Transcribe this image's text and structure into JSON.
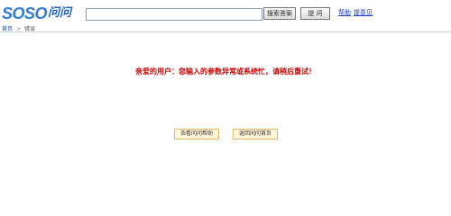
{
  "header": {
    "logo_soso": "SOSO",
    "logo_wenwen": "问问",
    "search_value": "",
    "search_button": "搜索答案",
    "ask_button": "提 问",
    "help_link": "帮助",
    "feedback_link": "提意见"
  },
  "breadcrumb": {
    "home": "首页",
    "separator": ">",
    "current": "错误"
  },
  "main": {
    "error_message": "亲爱的用户：您输入的参数异常或系统忙，请稍后重试！",
    "help_center_button": "去看问问帮助",
    "home_button": "返回问问首页"
  },
  "colors": {
    "error_text": "#cc0000",
    "link": "#1a3dc1",
    "logo_blue": "#2e7bd6",
    "action_button_bg": "#fff6d8",
    "action_button_border": "#e0b86a"
  }
}
